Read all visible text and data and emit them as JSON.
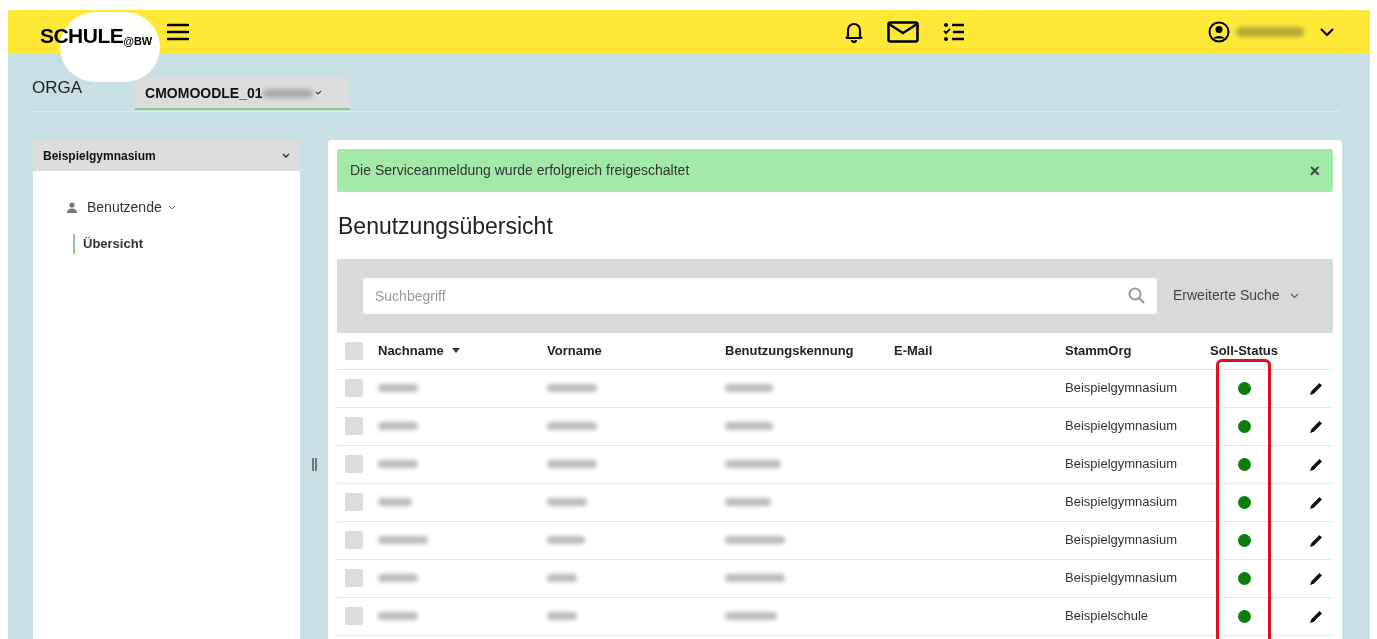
{
  "header": {
    "logo": "SCHULE",
    "logo_suffix": "@BW"
  },
  "org_bar": {
    "label": "ORGA",
    "dropdown": {
      "value": "CMOMOODLE_01"
    }
  },
  "sidebar": {
    "school": "Beispielgymnasium",
    "expanded": true,
    "items": [
      {
        "label": "Benutzende",
        "expanded": true,
        "children": [
          {
            "label": "Übersicht",
            "selected": true
          }
        ]
      }
    ]
  },
  "alert": {
    "text": "Die Serviceanmeldung wurde erfolgreich freigeschaltet",
    "close": "×"
  },
  "title": "Benutzungsübersicht",
  "search": {
    "placeholder": "Suchbegriff",
    "advanced": "Erweiterte Suche"
  },
  "table": {
    "select_all_checked": false,
    "columns": [
      {
        "label": "Nachname",
        "sorted": true
      },
      {
        "label": "Vorname",
        "sorted": false
      },
      {
        "label": "Benutzungskennung",
        "sorted": false
      },
      {
        "label": "E-Mail",
        "sorted": false
      },
      {
        "label": "StammOrg",
        "sorted": false
      },
      {
        "label": "Soll-Status",
        "sorted": false
      }
    ],
    "rows": [
      {
        "checked": false,
        "stammorg": "Beispielgymnasium",
        "color": "#0a7d0a"
      },
      {
        "checked": false,
        "stammorg": "Beispielgymnasium",
        "color": "#0a7d0a"
      },
      {
        "checked": false,
        "stammorg": "Beispielgymnasium",
        "color": "#0a7d0a"
      },
      {
        "checked": false,
        "stammorg": "Beispielgymnasium",
        "color": "#0a7d0a"
      },
      {
        "checked": false,
        "stammorg": "Beispielgymnasium",
        "color": "#0a7d0a"
      },
      {
        "checked": false,
        "stammorg": "Beispielgymnasium",
        "color": "#0a7d0a"
      },
      {
        "checked": false,
        "stammorg": "Beispielschule",
        "color": "#0a7d0a"
      }
    ]
  }
}
